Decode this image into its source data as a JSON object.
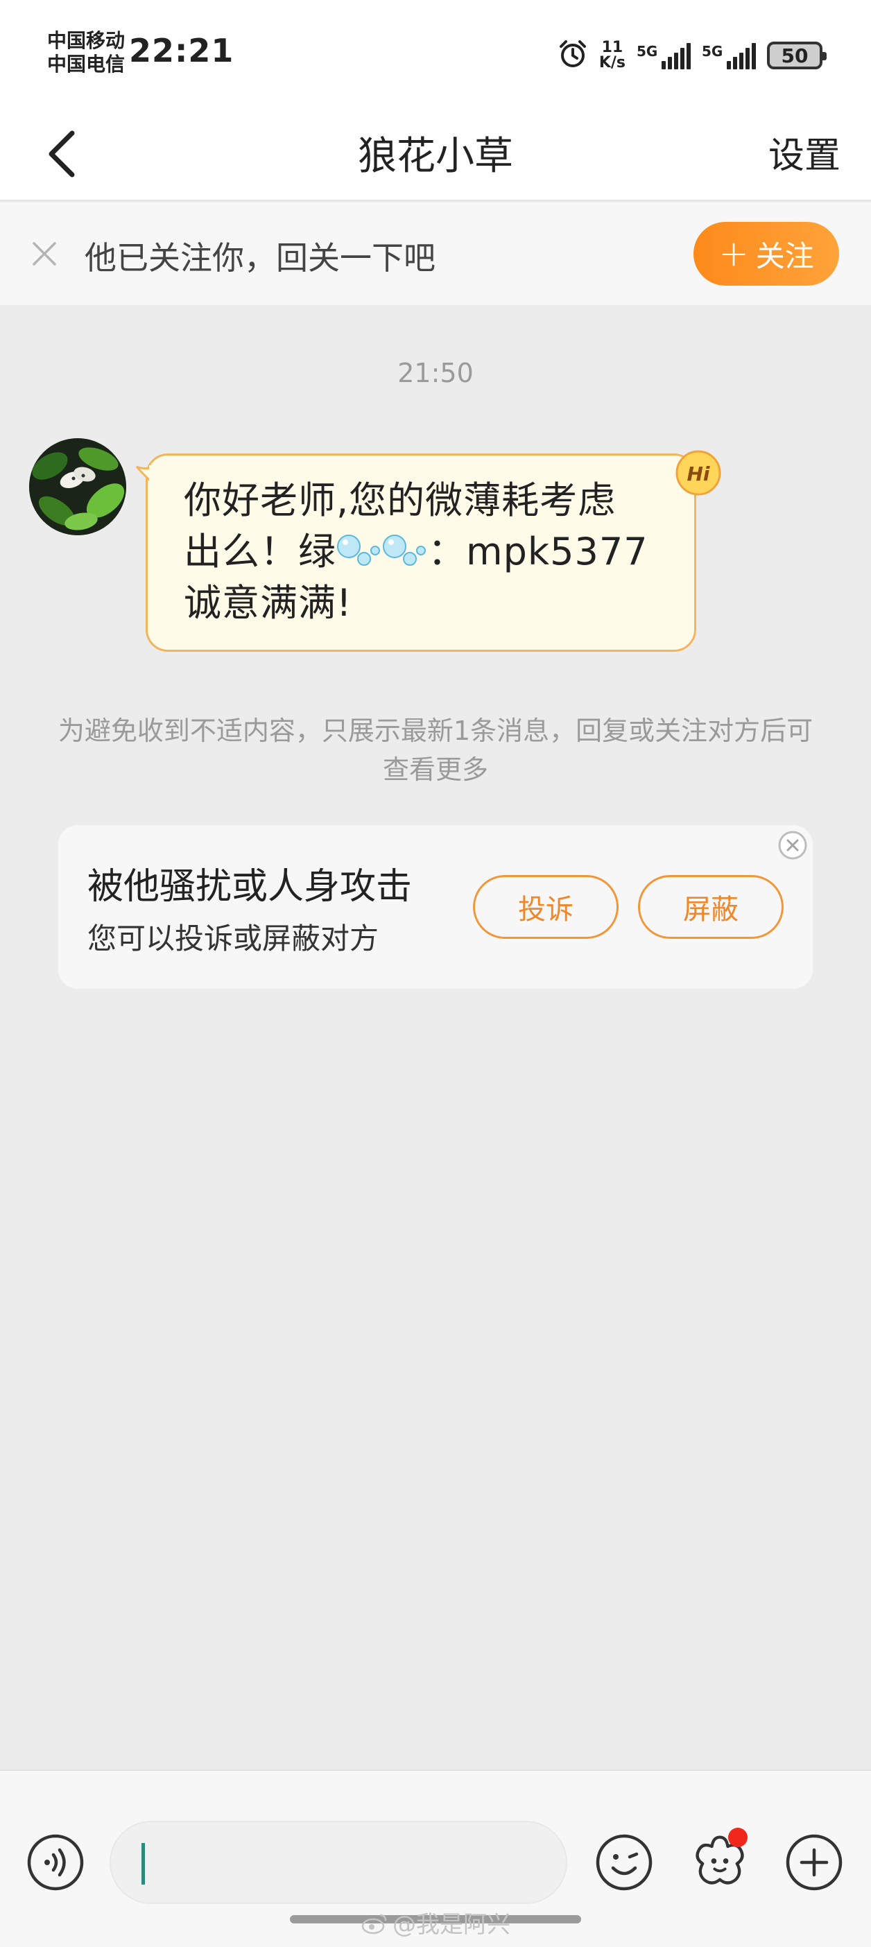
{
  "status_bar": {
    "carrier_1": "中国移动",
    "carrier_2": "中国电信",
    "time": "22:21",
    "net_speed_value": "11",
    "net_speed_unit": "K/s",
    "signal_1_label": "5G",
    "signal_2_label": "5G",
    "battery": "50"
  },
  "nav": {
    "title": "狼花小草",
    "settings_label": "设置"
  },
  "follow_banner": {
    "text": "他已关注你，回关一下吧",
    "follow_label": "关注",
    "follow_plus": "+"
  },
  "chat": {
    "timestamp": "21:50",
    "message": {
      "line1": "你好老师,您的微薄耗考虑",
      "line2_prefix": "出么！绿",
      "line2_suffix": "：mpk5377",
      "line3": "诚意满满!"
    },
    "badge_text": "Hi",
    "notice": "为避免收到不适内容，只展示最新1条消息，回复或关注对方后可查看更多"
  },
  "harass_card": {
    "title": "被他骚扰或人身攻击",
    "subtitle": "您可以投诉或屏蔽对方",
    "report_label": "投诉",
    "block_label": "屏蔽"
  },
  "input_bar": {
    "voice_icon": "voice-icon",
    "emoji_icon": "emoji-icon",
    "sticker_icon": "sticker-icon",
    "plus_icon": "plus-icon"
  },
  "watermark": "@我是阿兴",
  "colors": {
    "accent_orange": "#fd8a1b",
    "bubble_bg": "#fffbe9",
    "bubble_border": "#f2b55d",
    "notification_dot": "#f2271c"
  }
}
